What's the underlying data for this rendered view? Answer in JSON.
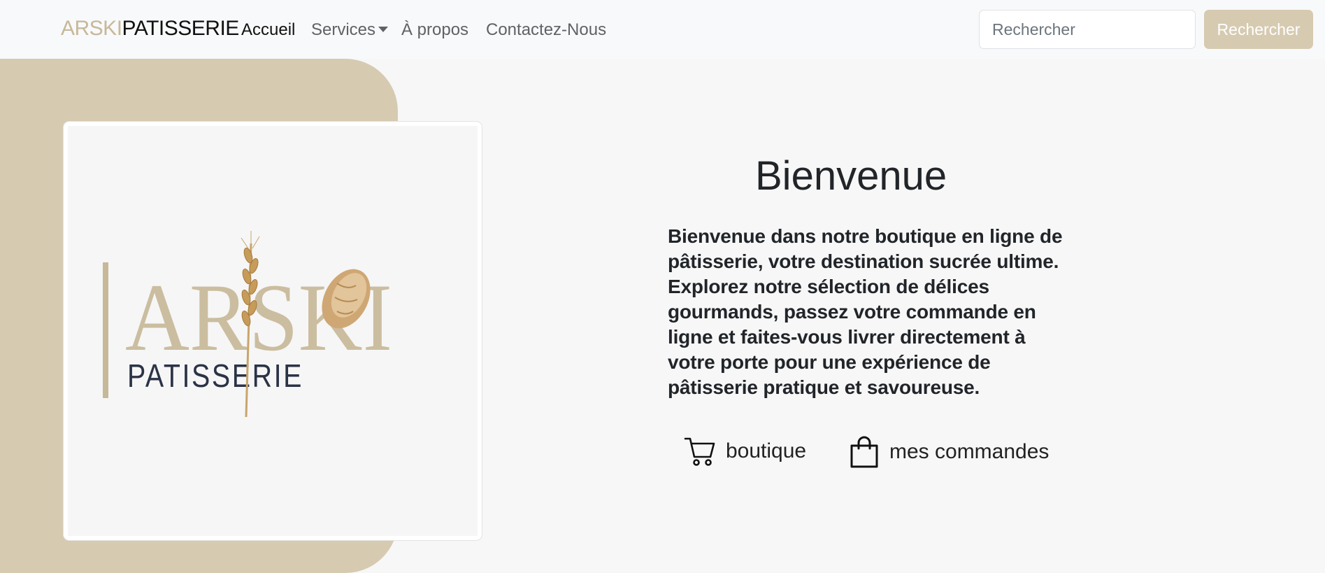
{
  "navbar": {
    "brand_part1": "ARSKI",
    "brand_part2": "PATISSERIE",
    "links": [
      {
        "label": "Accueil",
        "active": true
      },
      {
        "label": "Services",
        "dropdown": true
      },
      {
        "label": "À propos"
      },
      {
        "label": "Contactez-Nous"
      }
    ],
    "search_placeholder": "Rechercher",
    "search_button": "Rechercher"
  },
  "hero": {
    "logo": {
      "word": "ARSKI",
      "tagline": "PATISSERIE"
    },
    "title": "Bienvenue",
    "description": "Bienvenue dans notre boutique en ligne de pâtisserie, votre destination sucrée ultime. Explorez notre sélection de délices gourmands, passez votre commande en ligne et faites-vous livrer directement à votre porte pour une expérience de pâtisserie pratique et savoureuse.",
    "actions": [
      {
        "label": "boutique",
        "icon": "cart-icon"
      },
      {
        "label": "mes commandes",
        "icon": "shopping-bag-icon"
      }
    ]
  },
  "colors": {
    "accent": "#d6cab1",
    "brand_gold": "#c7b899",
    "logo_navy": "#2b3346",
    "background": "#f7f7f7"
  }
}
